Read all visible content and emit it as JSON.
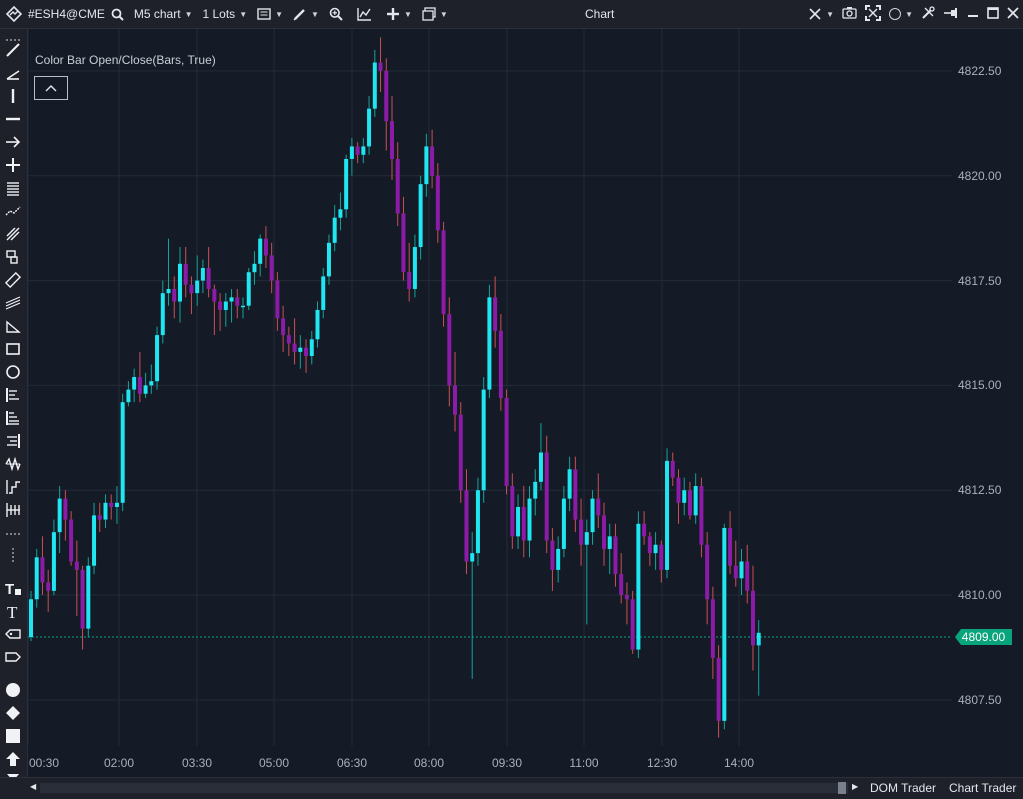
{
  "toolbar": {
    "symbol": "#ESH4@CME",
    "chart_type": "M5 chart",
    "lots": "1 Lots",
    "window_title": "Chart"
  },
  "indicator": {
    "label": "Color Bar Open/Close(Bars, True)"
  },
  "price_axis": {
    "labels": [
      "4822.50",
      "4820.00",
      "4817.50",
      "4815.00",
      "4812.50",
      "4810.00",
      "4807.50"
    ],
    "last_price": "4809.00"
  },
  "time_axis": {
    "labels": [
      "00:30",
      "02:00",
      "03:30",
      "05:00",
      "06:30",
      "08:00",
      "09:30",
      "11:00",
      "12:30",
      "14:00"
    ]
  },
  "statusbar": {
    "dom_trader": "DOM Trader",
    "chart_trader": "Chart Trader"
  },
  "colors": {
    "up": "#1fe6f0",
    "down": "#8c1ca8",
    "wick_up": "#13a59b",
    "wick_down": "#cc4f56",
    "background": "#141a26",
    "last_price": "#0aa47c"
  },
  "chart_data": {
    "type": "candlestick",
    "ylim": [
      4806.4,
      4823.5
    ],
    "y_ticks": [
      4807.5,
      4810.0,
      4812.5,
      4815.0,
      4817.5,
      4820.0,
      4822.5
    ],
    "last_price": 4809.0,
    "ohlc": [
      [
        4809.0,
        4810.1,
        4808.9,
        4809.9
      ],
      [
        4809.9,
        4811.1,
        4809.7,
        4810.9
      ],
      [
        4810.9,
        4811.4,
        4810.0,
        4810.3
      ],
      [
        4810.3,
        4810.6,
        4809.6,
        4810.1
      ],
      [
        4810.1,
        4811.8,
        4810.0,
        4811.5
      ],
      [
        4811.5,
        4812.6,
        4811.0,
        4812.3
      ],
      [
        4812.3,
        4812.5,
        4811.3,
        4811.8
      ],
      [
        4811.8,
        4812.0,
        4810.7,
        4810.8
      ],
      [
        4810.8,
        4811.3,
        4809.5,
        4810.6
      ],
      [
        4810.6,
        4810.7,
        4808.7,
        4809.2
      ],
      [
        4809.2,
        4810.9,
        4809.0,
        4810.7
      ],
      [
        4810.7,
        4812.2,
        4810.5,
        4811.9
      ],
      [
        4811.9,
        4812.2,
        4811.5,
        4811.8
      ],
      [
        4811.8,
        4812.4,
        4811.6,
        4812.2
      ],
      [
        4812.2,
        4812.4,
        4811.8,
        4812.1
      ],
      [
        4812.1,
        4812.6,
        4811.7,
        4812.2
      ],
      [
        4812.2,
        4814.8,
        4812.0,
        4814.6
      ],
      [
        4814.6,
        4815.1,
        4814.5,
        4814.9
      ],
      [
        4814.9,
        4815.4,
        4814.6,
        4815.2
      ],
      [
        4815.2,
        4815.8,
        4814.6,
        4814.8
      ],
      [
        4814.8,
        4815.3,
        4814.7,
        4815.0
      ],
      [
        4815.0,
        4815.5,
        4814.8,
        4815.1
      ],
      [
        4815.1,
        4816.4,
        4814.9,
        4816.2
      ],
      [
        4816.2,
        4817.5,
        4816.0,
        4817.2
      ],
      [
        4817.2,
        4818.5,
        4816.9,
        4817.3
      ],
      [
        4817.3,
        4817.6,
        4816.6,
        4817.0
      ],
      [
        4817.0,
        4818.3,
        4816.5,
        4817.9
      ],
      [
        4817.9,
        4818.3,
        4817.1,
        4817.4
      ],
      [
        4817.4,
        4817.6,
        4816.7,
        4817.2
      ],
      [
        4817.2,
        4818.1,
        4816.9,
        4817.5
      ],
      [
        4817.5,
        4818.0,
        4817.2,
        4817.8
      ],
      [
        4817.8,
        4818.3,
        4817.1,
        4817.3
      ],
      [
        4817.3,
        4817.4,
        4816.2,
        4817.0
      ],
      [
        4817.0,
        4817.2,
        4816.3,
        4816.8
      ],
      [
        4816.8,
        4817.2,
        4816.4,
        4817.0
      ],
      [
        4817.0,
        4817.3,
        4816.5,
        4817.1
      ],
      [
        4817.1,
        4817.3,
        4816.6,
        4816.9
      ],
      [
        4816.9,
        4817.1,
        4816.6,
        4816.9
      ],
      [
        4816.9,
        4817.8,
        4816.8,
        4817.7
      ],
      [
        4817.7,
        4818.2,
        4817.4,
        4817.9
      ],
      [
        4817.9,
        4818.6,
        4817.6,
        4818.5
      ],
      [
        4818.5,
        4818.8,
        4817.8,
        4818.1
      ],
      [
        4818.1,
        4818.4,
        4817.2,
        4817.5
      ],
      [
        4817.5,
        4817.7,
        4816.3,
        4816.6
      ],
      [
        4816.6,
        4816.9,
        4815.8,
        4816.2
      ],
      [
        4816.2,
        4816.4,
        4815.7,
        4816.0
      ],
      [
        4816.0,
        4816.6,
        4815.5,
        4815.8
      ],
      [
        4815.8,
        4816.2,
        4815.4,
        4815.9
      ],
      [
        4815.9,
        4816.1,
        4815.3,
        4815.7
      ],
      [
        4815.7,
        4816.3,
        4815.5,
        4816.1
      ],
      [
        4816.1,
        4817.0,
        4815.9,
        4816.8
      ],
      [
        4816.8,
        4817.8,
        4816.6,
        4817.6
      ],
      [
        4817.6,
        4818.6,
        4817.4,
        4818.4
      ],
      [
        4818.4,
        4819.3,
        4818.2,
        4819.0
      ],
      [
        4819.0,
        4819.6,
        4818.7,
        4819.2
      ],
      [
        4819.2,
        4820.5,
        4819.0,
        4820.4
      ],
      [
        4820.4,
        4820.9,
        4820.0,
        4820.7
      ],
      [
        4820.7,
        4820.8,
        4820.3,
        4820.5
      ],
      [
        4820.5,
        4820.9,
        4820.3,
        4820.7
      ],
      [
        4820.7,
        4821.9,
        4820.5,
        4821.6
      ],
      [
        4821.6,
        4823.0,
        4821.4,
        4822.7
      ],
      [
        4822.7,
        4823.3,
        4822.0,
        4822.5
      ],
      [
        4822.5,
        4822.8,
        4820.6,
        4821.3
      ],
      [
        4821.3,
        4821.9,
        4819.9,
        4820.4
      ],
      [
        4820.4,
        4820.8,
        4818.8,
        4819.1
      ],
      [
        4819.1,
        4819.5,
        4817.5,
        4817.7
      ],
      [
        4817.7,
        4818.4,
        4817.0,
        4817.3
      ],
      [
        4817.3,
        4818.6,
        4817.1,
        4818.3
      ],
      [
        4818.3,
        4820.0,
        4818.0,
        4819.8
      ],
      [
        4819.8,
        4821.0,
        4819.5,
        4820.7
      ],
      [
        4820.7,
        4821.1,
        4819.7,
        4820.0
      ],
      [
        4820.0,
        4820.3,
        4818.4,
        4818.7
      ],
      [
        4818.7,
        4818.9,
        4816.4,
        4816.7
      ],
      [
        4816.7,
        4817.1,
        4814.5,
        4815.0
      ],
      [
        4815.0,
        4815.8,
        4813.9,
        4814.3
      ],
      [
        4814.3,
        4814.6,
        4812.2,
        4812.5
      ],
      [
        4812.5,
        4813.0,
        4810.5,
        4810.8
      ],
      [
        4810.8,
        4811.5,
        4808.0,
        4811.0
      ],
      [
        4811.0,
        4812.8,
        4810.7,
        4812.5
      ],
      [
        4812.5,
        4815.2,
        4812.2,
        4814.9
      ],
      [
        4814.9,
        4817.4,
        4814.7,
        4817.1
      ],
      [
        4817.1,
        4817.6,
        4815.9,
        4816.3
      ],
      [
        4816.3,
        4816.7,
        4814.4,
        4814.7
      ],
      [
        4814.7,
        4814.9,
        4812.4,
        4812.6
      ],
      [
        4812.6,
        4812.9,
        4811.1,
        4811.4
      ],
      [
        4811.4,
        4812.4,
        4811.1,
        4812.1
      ],
      [
        4812.1,
        4812.6,
        4810.9,
        4811.3
      ],
      [
        4811.3,
        4812.6,
        4810.9,
        4812.3
      ],
      [
        4812.3,
        4813.0,
        4811.9,
        4812.7
      ],
      [
        4812.7,
        4814.1,
        4812.5,
        4813.4
      ],
      [
        4813.4,
        4813.8,
        4811.0,
        4811.3
      ],
      [
        4811.3,
        4811.6,
        4810.1,
        4810.6
      ],
      [
        4810.6,
        4811.4,
        4810.3,
        4811.1
      ],
      [
        4811.1,
        4812.6,
        4810.9,
        4812.3
      ],
      [
        4812.3,
        4813.3,
        4812.0,
        4813.0
      ],
      [
        4813.0,
        4813.3,
        4811.5,
        4811.8
      ],
      [
        4811.8,
        4812.3,
        4810.7,
        4811.2
      ],
      [
        4811.2,
        4811.8,
        4809.3,
        4811.5
      ],
      [
        4811.5,
        4812.5,
        4811.2,
        4812.3
      ],
      [
        4812.3,
        4812.9,
        4811.6,
        4811.9
      ],
      [
        4811.9,
        4812.2,
        4810.7,
        4811.1
      ],
      [
        4811.1,
        4811.7,
        4810.5,
        4811.4
      ],
      [
        4811.4,
        4811.7,
        4810.2,
        4810.5
      ],
      [
        4810.5,
        4811.0,
        4809.8,
        4810.0
      ],
      [
        4810.0,
        4810.3,
        4809.3,
        4809.9
      ],
      [
        4809.9,
        4810.1,
        4808.6,
        4808.7
      ],
      [
        4808.7,
        4812.0,
        4808.5,
        4811.7
      ],
      [
        4811.7,
        4812.0,
        4811.2,
        4811.4
      ],
      [
        4811.4,
        4811.5,
        4810.7,
        4811.0
      ],
      [
        4811.0,
        4811.5,
        4810.6,
        4811.2
      ],
      [
        4811.2,
        4811.3,
        4810.3,
        4810.6
      ],
      [
        4810.6,
        4813.5,
        4810.4,
        4813.2
      ],
      [
        4813.2,
        4813.4,
        4812.6,
        4812.8
      ],
      [
        4812.8,
        4813.0,
        4811.7,
        4812.2
      ],
      [
        4812.2,
        4812.8,
        4811.9,
        4812.5
      ],
      [
        4812.5,
        4812.7,
        4811.8,
        4811.9
      ],
      [
        4811.9,
        4812.9,
        4811.7,
        4812.6
      ],
      [
        4812.6,
        4812.8,
        4810.9,
        4811.2
      ],
      [
        4811.2,
        4811.5,
        4809.3,
        4809.9
      ],
      [
        4809.9,
        4810.2,
        4808.0,
        4808.5
      ],
      [
        4808.5,
        4808.8,
        4806.6,
        4807.0
      ],
      [
        4807.0,
        4811.7,
        4806.8,
        4811.6
      ],
      [
        4811.6,
        4812.0,
        4810.5,
        4810.7
      ],
      [
        4810.7,
        4811.3,
        4810.2,
        4810.4
      ],
      [
        4810.4,
        4811.1,
        4810.0,
        4810.8
      ],
      [
        4810.8,
        4811.2,
        4809.8,
        4810.1
      ],
      [
        4810.1,
        4810.7,
        4808.2,
        4808.8
      ],
      [
        4808.8,
        4809.4,
        4807.6,
        4809.1
      ]
    ]
  }
}
